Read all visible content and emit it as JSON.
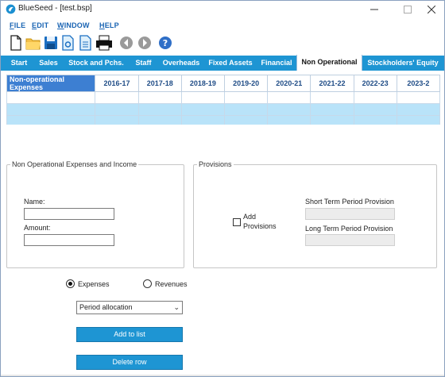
{
  "window": {
    "title": "BlueSeed - [test.bsp]"
  },
  "menu": [
    {
      "pre": "",
      "u": "F",
      "post": "ILE"
    },
    {
      "pre": "",
      "u": "E",
      "post": "DIT"
    },
    {
      "pre": "",
      "u": "W",
      "post": "INDOW"
    },
    {
      "pre": "",
      "u": "H",
      "post": "ELP"
    }
  ],
  "toolbar": [
    "new-document",
    "open-folder",
    "save",
    "save-as",
    "properties",
    "print",
    "back",
    "forward",
    "help"
  ],
  "tabs": [
    "Start",
    "Sales",
    "Stock and Pchs.",
    "Staff",
    "Overheads",
    "Fixed Assets",
    "Financial",
    "Non Operational",
    "Stockholders' Equity"
  ],
  "active_tab": "Non Operational",
  "grid": {
    "columns": [
      "Non-operational Expenses",
      "2016-17",
      "2017-18",
      "2018-19",
      "2019-20",
      "2020-21",
      "2021-22",
      "2022-23",
      "2023-2"
    ],
    "rows": [
      [
        "",
        "",
        "",
        "",
        "",
        "",
        "",
        "",
        ""
      ],
      [
        "",
        "",
        "",
        "",
        "",
        "",
        "",
        "",
        ""
      ],
      [
        "",
        "",
        "",
        "",
        "",
        "",
        "",
        "",
        ""
      ]
    ]
  },
  "left_group": {
    "title": "Non Operational Expenses and Income",
    "name_label": "Name:",
    "name_value": "",
    "amount_label": "Amount:",
    "amount_value": ""
  },
  "provisions_group": {
    "title": "Provisions",
    "add_label_line1": "Add",
    "add_label_line2": "Provisions",
    "add_checked": false,
    "short_label": "Short Term Period Provision",
    "short_value": "",
    "long_label": "Long Term Period Provision",
    "long_value": ""
  },
  "type_radio": {
    "expenses_label": "Expenses",
    "revenues_label": "Revenues",
    "selected": "Expenses"
  },
  "period_select": {
    "selected": "Period allocation"
  },
  "buttons": {
    "add": "Add to list",
    "delete": "Delete row"
  },
  "colors": {
    "accent": "#1e95d3",
    "grid_header_active": "#3d7fd2",
    "grid_row": "#b9e3f9",
    "menu": "#1a64b3"
  }
}
